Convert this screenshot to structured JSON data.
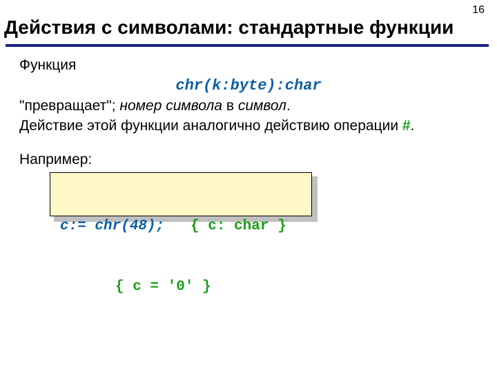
{
  "page_number": "16",
  "title": "Действия с символами: стандартные функции",
  "body": {
    "line1": "Функция",
    "signature": "chr(k:byte):char",
    "line2_a": "\"превращает\"; ",
    "line2_b": "номер символа",
    "line2_c": " в ",
    "line2_d": "символ",
    "line2_e": ".",
    "line3_a": "Действие этой функции аналогично действию операции ",
    "line3_hash": "#",
    "line3_b": ".",
    "example_label": "Например:"
  },
  "code": {
    "l1_stmt": "c:= chr(48);",
    "l1_comment": "{ c: char }",
    "l2_comment": "{ c = '0' }"
  }
}
